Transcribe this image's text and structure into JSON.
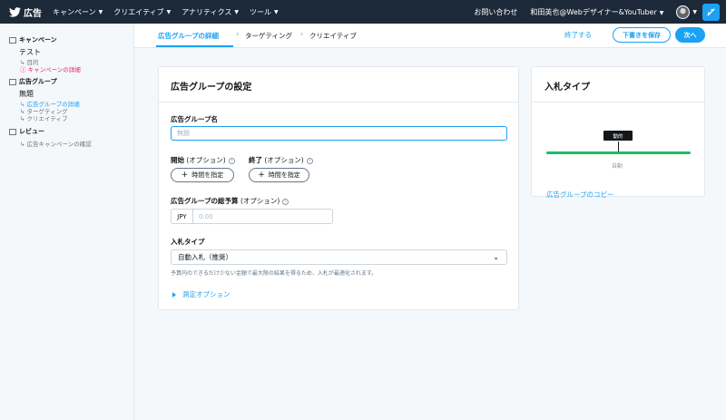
{
  "nav": {
    "brand": "広告",
    "menus": [
      "キャンペーン",
      "クリエイティブ",
      "アナリティクス",
      "ツール"
    ],
    "contact": "お問い合わせ",
    "account": "和田英也@Webデザイナー&YouTuber"
  },
  "sidebar": {
    "campaign_header": "キャンペーン",
    "campaign_name": "テスト",
    "campaign_sub_objective": "目的",
    "campaign_sub_details": "キャンペーンの詳細",
    "adgroup_header": "広告グループ",
    "adgroup_name": "無題",
    "adgroup_sub_details": "広告グループの詳細",
    "adgroup_sub_targeting": "ターゲティング",
    "adgroup_sub_creative": "クリエイティブ",
    "review_header": "レビュー",
    "review_sub": "広告キャンペーンの確認"
  },
  "stepper": {
    "steps": [
      "広告グループの詳細",
      "ターゲティング",
      "クリエイティブ"
    ],
    "exit": "終了する",
    "save_draft": "下書きを保存",
    "next": "次へ"
  },
  "form": {
    "title": "広告グループの設定",
    "name_label": "広告グループ名",
    "name_placeholder": "無題",
    "start_label": "開始",
    "start_optional": " (オプション)",
    "end_label": "終了",
    "end_optional": " (オプション)",
    "set_time": "時間を指定",
    "budget_label": "広告グループの総予算",
    "budget_optional": " (オプション)",
    "budget_currency": "JPY",
    "budget_placeholder": "0.00",
    "bid_label": "入札タイプ",
    "bid_value": "自動入札（推奨）",
    "bid_help": "予算内のできるだけ少ない金額で最大限の結果を得るため、入札が最適化されます。",
    "measurement": "測定オプション"
  },
  "bid_panel": {
    "title": "入札タイプ",
    "flag": "動的",
    "caption": "自動",
    "copy_link": "広告グループのコピー"
  },
  "colors": {
    "accent": "#1da1f2",
    "navbar": "#1c2938",
    "slider": "#17bf63",
    "error": "#e0245e"
  }
}
